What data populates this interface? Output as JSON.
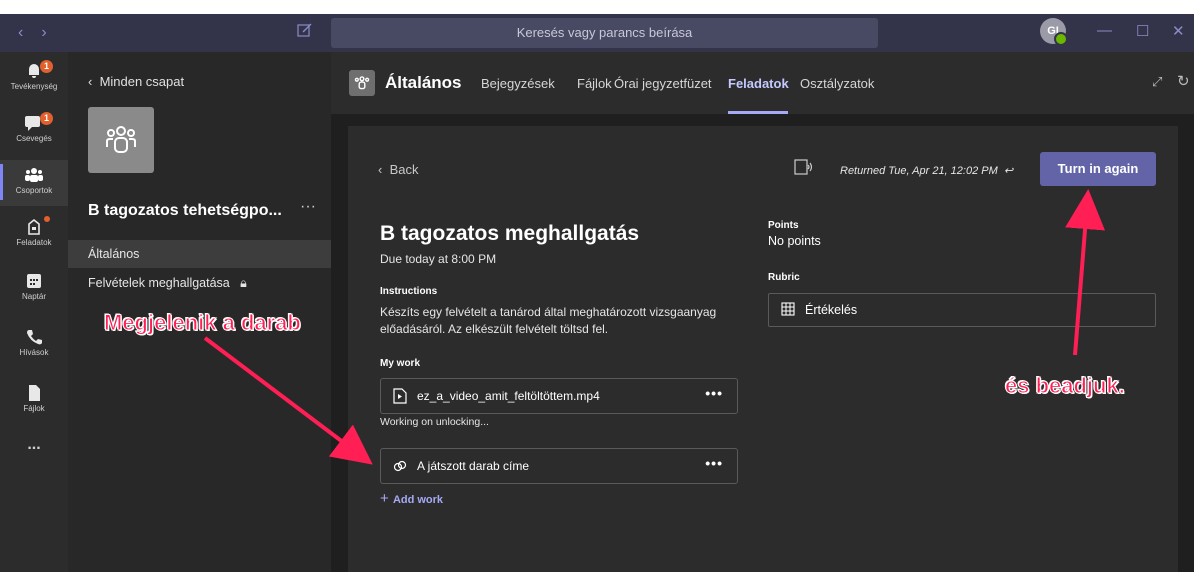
{
  "search": {
    "placeholder": "Keresés vagy parancs beírása"
  },
  "user": {
    "initials": "GI"
  },
  "rail": [
    {
      "label": "Tevékenység",
      "icon": "bell-icon",
      "badge": "1"
    },
    {
      "label": "Csevegés",
      "icon": "chat-icon",
      "badge": "1"
    },
    {
      "label": "Csoportok",
      "icon": "teams-icon"
    },
    {
      "label": "Feladatok",
      "icon": "assignments-icon"
    },
    {
      "label": "Naptár",
      "icon": "calendar-icon"
    },
    {
      "label": "Hívások",
      "icon": "phone-icon"
    },
    {
      "label": "Fájlok",
      "icon": "files-icon"
    },
    {
      "label": "...",
      "icon": "more-icon"
    }
  ],
  "panel": {
    "back_label": "Minden csapat",
    "team_name": "B tagozatos tehetségpo...",
    "team_more": "···",
    "channels": [
      "Általános",
      "Felvételek meghallgatása"
    ]
  },
  "header": {
    "channel": "Általános",
    "tabs": [
      "Bejegyzések",
      "Fájlok",
      "Órai jegyzetfüzet",
      "Feladatok",
      "Osztályzatok"
    ],
    "active_tab": "Feladatok"
  },
  "assignment": {
    "back": "Back",
    "returned": "Returned Tue, Apr 21, 12:02 PM",
    "turn_in": "Turn in again",
    "title": "B tagozatos meghallgatás",
    "due": "Due today at 8:00 PM",
    "instructions_label": "Instructions",
    "instructions": "Készíts egy felvételt a tanárod által meghatározott vizsgaanyag előadásáról. Az elkészült felvételt töltsd fel.",
    "my_work_label": "My work",
    "files": [
      {
        "name": "ez_a_video_amit_feltöltöttem.mp4",
        "icon": "video-file-icon"
      },
      {
        "name": "A játszott darab címe",
        "icon": "link-icon"
      }
    ],
    "unlocking": "Working on unlocking...",
    "add_work": "Add work",
    "points_label": "Points",
    "points_value": "No points",
    "rubric_label": "Rubric",
    "rubric_value": "Értékelés"
  },
  "annotations": {
    "left": "Megjelenik a darab",
    "right": "és beadjuk."
  },
  "colors": {
    "accent": "#6264a7",
    "annotation": "#ff1f55",
    "badge": "#e1602d"
  }
}
